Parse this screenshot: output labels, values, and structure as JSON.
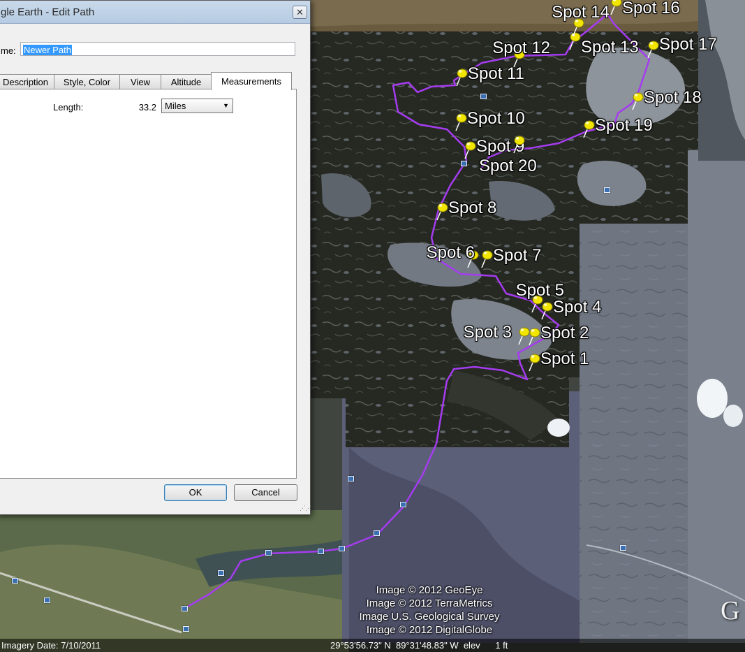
{
  "map": {
    "attribution": [
      "Image © 2012 GeoEye",
      "Image © 2012 TerraMetrics",
      "Image U.S. Geological Survey",
      "Image © 2012 DigitalGlobe"
    ],
    "logo_text": "G",
    "status": {
      "imagery_date": "Imagery Date: 7/10/2011",
      "coordinates": "29°53'56.73\" N  89°31'48.83\" W  elev      1 ft"
    },
    "path_color": "#a53cf0",
    "pin_color": "#f2e600",
    "placemarks": [
      {
        "label": "Spot 1"
      },
      {
        "label": "Spot 2"
      },
      {
        "label": "Spot 3"
      },
      {
        "label": "Spot 4"
      },
      {
        "label": "Spot 5"
      },
      {
        "label": "Spot 6"
      },
      {
        "label": "Spot 7"
      },
      {
        "label": "Spot 8"
      },
      {
        "label": "Spot 9"
      },
      {
        "label": "Spot 10"
      },
      {
        "label": "Spot 11"
      },
      {
        "label": "Spot 12"
      },
      {
        "label": "Spot 13"
      },
      {
        "label": "Spot 14"
      },
      {
        "label": "Spot 16"
      },
      {
        "label": "Spot 17"
      },
      {
        "label": "Spot 18"
      },
      {
        "label": "Spot 19"
      },
      {
        "label": "Spot 20"
      }
    ]
  },
  "dialog": {
    "title": "gle Earth - Edit Path",
    "close_glyph": "✕",
    "name_label": "me:",
    "name_value": "Newer Path",
    "tabs": [
      {
        "label": "Description"
      },
      {
        "label": "Style, Color"
      },
      {
        "label": "View"
      },
      {
        "label": "Altitude"
      },
      {
        "label": "Measurements",
        "active": true
      }
    ],
    "measurements": {
      "length_label": "Length:",
      "length_value": "33.2",
      "units": "Miles"
    },
    "buttons": {
      "ok": "OK",
      "cancel": "Cancel"
    }
  }
}
